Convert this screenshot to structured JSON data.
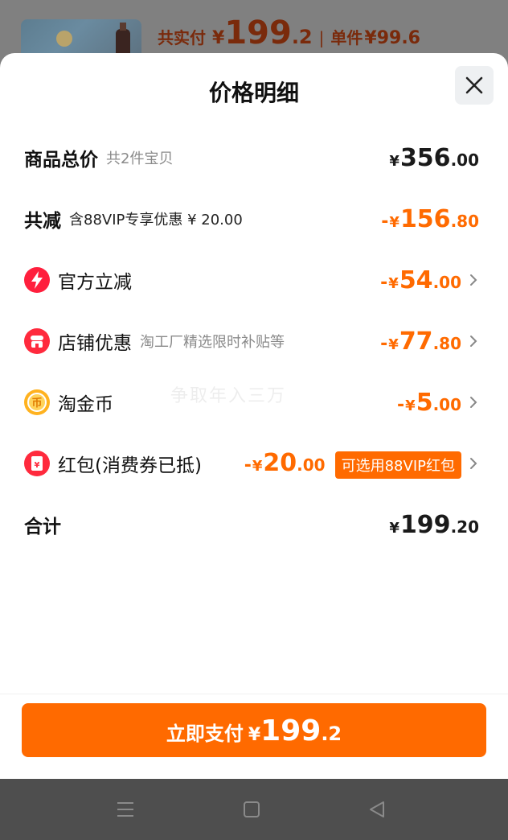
{
  "background": {
    "paid_label": "共实付",
    "paid_currency": "¥",
    "paid_int": "199",
    "paid_dec": ".2",
    "separator": "|",
    "unit_label": "单件",
    "unit_price": "¥99.6"
  },
  "sheet": {
    "title": "价格明细",
    "close_icon": "close-icon"
  },
  "rows": {
    "total": {
      "label": "商品总价",
      "sub": "共2件宝贝",
      "currency": "¥",
      "int": "356",
      "dec": ".00"
    },
    "reduction": {
      "label": "共减",
      "sub": "含88VIP专享优惠 ¥ 20.00",
      "neg": "-",
      "currency": "¥",
      "int": "156",
      "dec": ".80"
    },
    "official": {
      "label": "官方立减",
      "icon": "lightning-icon",
      "neg": "-",
      "currency": "¥",
      "int": "54",
      "dec": ".00"
    },
    "shop": {
      "label": "店铺优惠",
      "sub": "淘工厂精选限时补贴等",
      "icon": "shop-icon",
      "neg": "-",
      "currency": "¥",
      "int": "77",
      "dec": ".80"
    },
    "coins": {
      "label": "淘金币",
      "icon": "coin-icon",
      "neg": "-",
      "currency": "¥",
      "int": "5",
      "dec": ".00"
    },
    "redpacket": {
      "label": "红包(消费券已抵)",
      "icon": "red-packet-icon",
      "neg": "-",
      "currency": "¥",
      "int": "20",
      "dec": ".00",
      "tag": "可选用88VIP红包"
    },
    "sum": {
      "label": "合计",
      "currency": "¥",
      "int": "199",
      "dec": ".20"
    }
  },
  "watermark": "争取年入三万",
  "footer": {
    "pay_label": "立即支付",
    "currency": "¥",
    "int": "199",
    "dec": ".2"
  },
  "colors": {
    "accent": "#ff6a00",
    "text": "#111111",
    "muted": "#8a8a8a"
  }
}
